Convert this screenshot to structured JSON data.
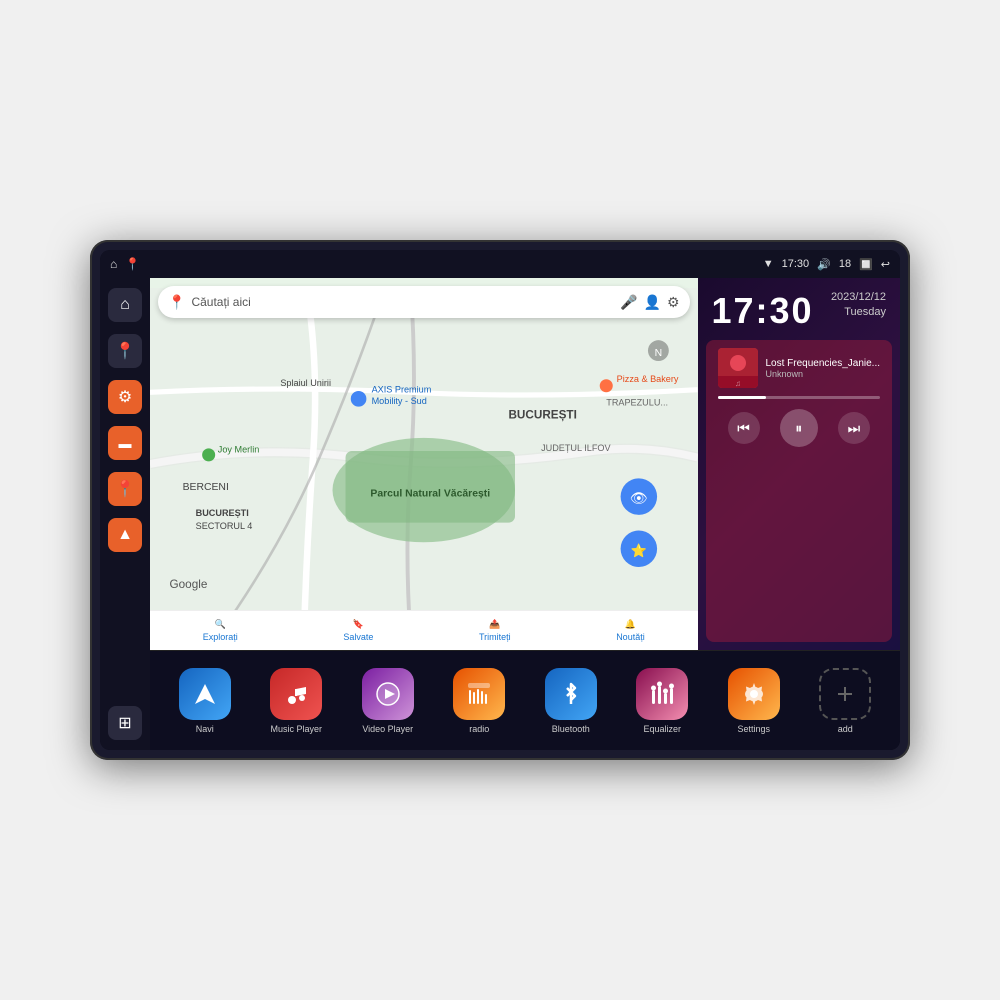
{
  "device": {
    "statusBar": {
      "wifi": "▼",
      "time": "17:30",
      "volume": "🔊",
      "battery": "18",
      "batteryIcon": "🔋",
      "back": "↩"
    },
    "sidebar": {
      "items": [
        {
          "label": "home",
          "icon": "⌂",
          "style": "dark"
        },
        {
          "label": "map-pin",
          "icon": "📍",
          "style": "dark"
        },
        {
          "label": "settings",
          "icon": "⚙",
          "style": "orange"
        },
        {
          "label": "folder",
          "icon": "▬",
          "style": "orange"
        },
        {
          "label": "location",
          "icon": "📍",
          "style": "orange"
        },
        {
          "label": "nav",
          "icon": "▲",
          "style": "orange"
        },
        {
          "label": "grid",
          "icon": "⊞",
          "style": "dark"
        }
      ]
    },
    "map": {
      "searchPlaceholder": "Căutați aici",
      "bottomItems": [
        {
          "label": "Explorați",
          "icon": "🔍"
        },
        {
          "label": "Salvate",
          "icon": "🔖"
        },
        {
          "label": "Trimiteți",
          "icon": "📤"
        },
        {
          "label": "Noutăți",
          "icon": "🔔"
        }
      ]
    },
    "clock": {
      "time": "17:30",
      "date": "2023/12/12",
      "day": "Tuesday"
    },
    "music": {
      "trackName": "Lost Frequencies_Janie...",
      "artist": "Unknown",
      "controls": {
        "prev": "⏮",
        "pause": "⏸",
        "next": "⏭"
      }
    },
    "apps": [
      {
        "label": "Navi",
        "icon": "▲",
        "style": "navi"
      },
      {
        "label": "Music Player",
        "icon": "♪",
        "style": "music"
      },
      {
        "label": "Video Player",
        "icon": "▶",
        "style": "video"
      },
      {
        "label": "radio",
        "icon": "📡",
        "style": "radio"
      },
      {
        "label": "Bluetooth",
        "icon": "⚡",
        "style": "bluetooth"
      },
      {
        "label": "Equalizer",
        "icon": "≡",
        "style": "equalizer"
      },
      {
        "label": "Settings",
        "icon": "⚙",
        "style": "settings"
      },
      {
        "label": "add",
        "icon": "+",
        "style": "add"
      }
    ]
  }
}
